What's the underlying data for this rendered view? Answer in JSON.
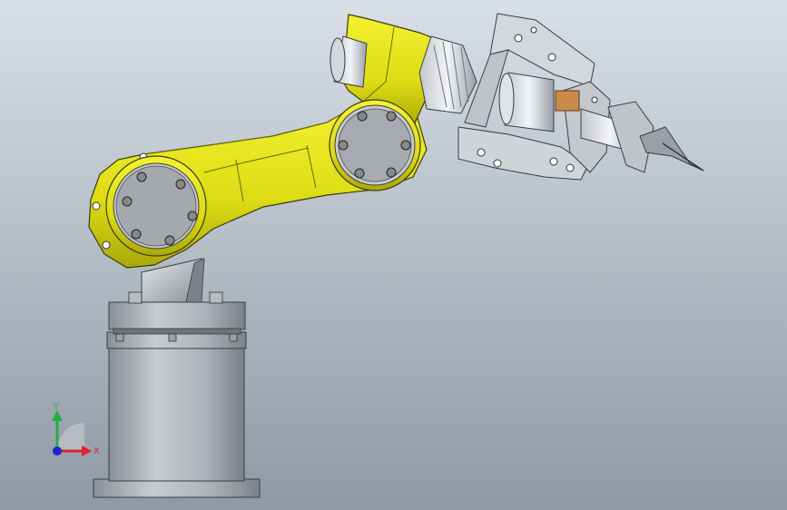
{
  "viewport": {
    "background_top": "#d7dde4",
    "background_bottom": "#8f9aa6"
  },
  "colors": {
    "arm_yellow": "#e8e61c",
    "arm_yellow_shade": "#b9b90c",
    "steel": "#b3b7bd",
    "steel_dark": "#6f747a",
    "plate": "#c9cdd3"
  },
  "triad": {
    "x_label": "X",
    "y_label": "Y",
    "x_color": "#e0202a",
    "y_color": "#20b040",
    "z_color": "#2020d0"
  }
}
